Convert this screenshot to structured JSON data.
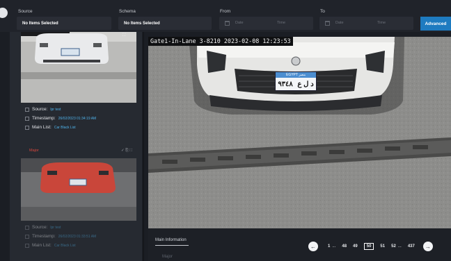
{
  "filters": {
    "source": {
      "label": "Source",
      "value": "No Items Selected"
    },
    "schema": {
      "label": "Schema",
      "value": "No Items Selected"
    },
    "from": {
      "label": "From",
      "date_placeholder": "Date",
      "time_placeholder": "Time"
    },
    "to": {
      "label": "To",
      "date_placeholder": "Date",
      "time_placeholder": "Time"
    },
    "advanced_button": "Advanced"
  },
  "detections": [
    {
      "source_label": "Source:",
      "source_value": "lpr test",
      "timestamp_label": "Timestamp:",
      "timestamp_value": "26/02/2023 01:34:19 AM",
      "list_label": "Main List:",
      "list_value": "Car Black List",
      "car_color": "#e9eaec"
    },
    {
      "title": "Major",
      "icons_text": "✓ ⎘ ⛶",
      "source_label": "Source:",
      "source_value": "lpr test",
      "timestamp_label": "Timestamp:",
      "timestamp_value": "26/02/2023 01:33:51 AM",
      "list_label": "Main List:",
      "list_value": "Car Black List",
      "car_color": "#c9463a"
    }
  ],
  "main_view": {
    "caption": "Gate1-In-Lane 3-8210 2023-02-08 12:23:53",
    "plate_header": "EGYPT مصر",
    "plate_number": "٩٣٤٨",
    "plate_letters": "د ل ع"
  },
  "bottom": {
    "tab_label": "Main Information",
    "sub_label": "Major"
  },
  "pagination": {
    "prev_icon": "arrow-left-icon",
    "next_icon": "arrow-right-icon",
    "pages": [
      "1",
      "...",
      "48",
      "49",
      "50",
      "51",
      "52",
      "...",
      "437"
    ],
    "current": "50"
  },
  "colors": {
    "accent": "#1e7bc0",
    "link_value": "#4fb2ea",
    "alert": "#d8473d"
  }
}
